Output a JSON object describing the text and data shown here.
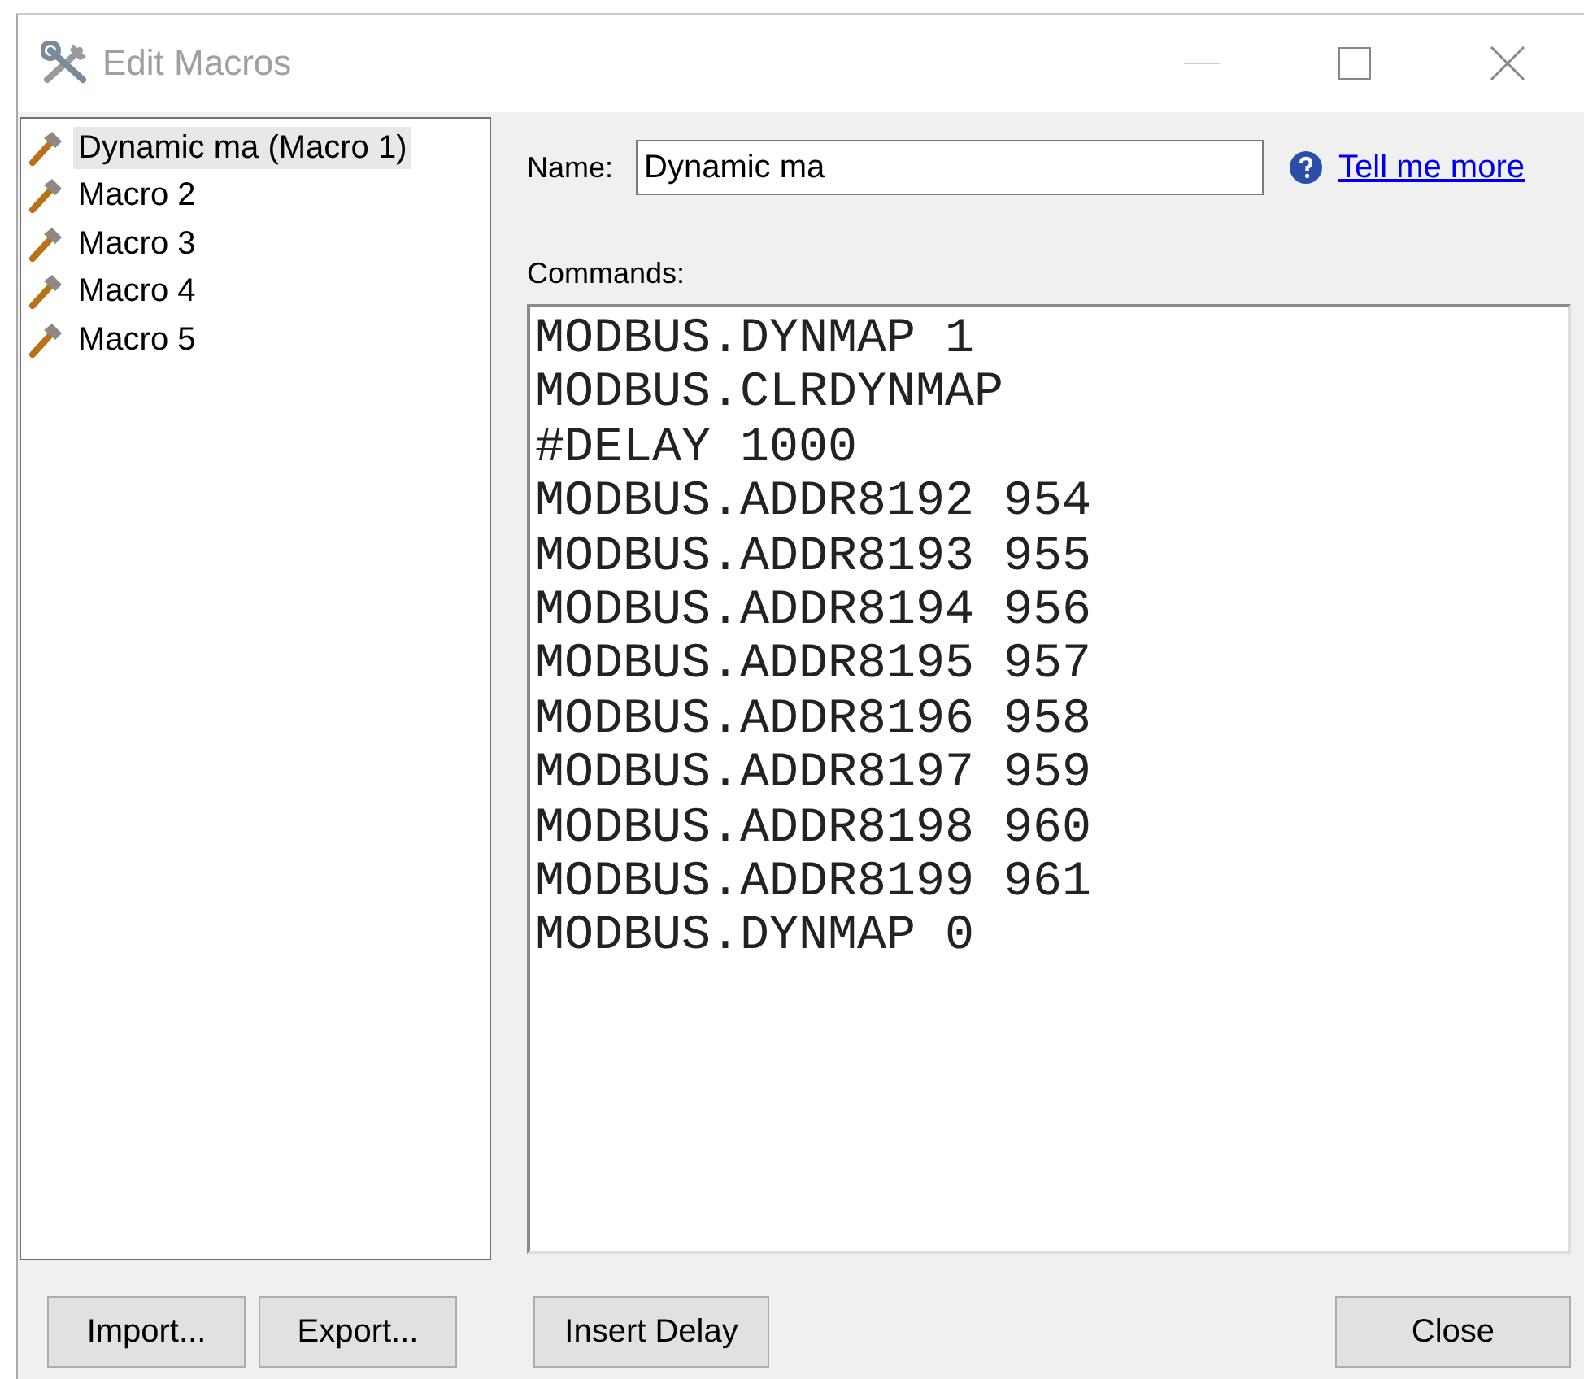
{
  "window": {
    "title": "Edit Macros"
  },
  "macros": [
    {
      "label": "Dynamic ma (Macro 1)",
      "selected": true
    },
    {
      "label": "Macro 2",
      "selected": false
    },
    {
      "label": "Macro 3",
      "selected": false
    },
    {
      "label": "Macro 4",
      "selected": false
    },
    {
      "label": "Macro 5",
      "selected": false
    }
  ],
  "name_field": {
    "label": "Name:",
    "value": "Dynamic ma"
  },
  "help_link": "Tell me more",
  "commands": {
    "label": "Commands:",
    "lines": [
      "MODBUS.DYNMAP 1",
      "MODBUS.CLRDYNMAP",
      "#DELAY 1000",
      "MODBUS.ADDR8192 954",
      "MODBUS.ADDR8193 955",
      "MODBUS.ADDR8194 956",
      "MODBUS.ADDR8195 957",
      "MODBUS.ADDR8196 958",
      "MODBUS.ADDR8197 959",
      "MODBUS.ADDR8198 960",
      "MODBUS.ADDR8199 961",
      "MODBUS.DYNMAP 0"
    ]
  },
  "buttons": {
    "import": "Import...",
    "export": "Export...",
    "insert_delay": "Insert Delay",
    "close": "Close"
  }
}
